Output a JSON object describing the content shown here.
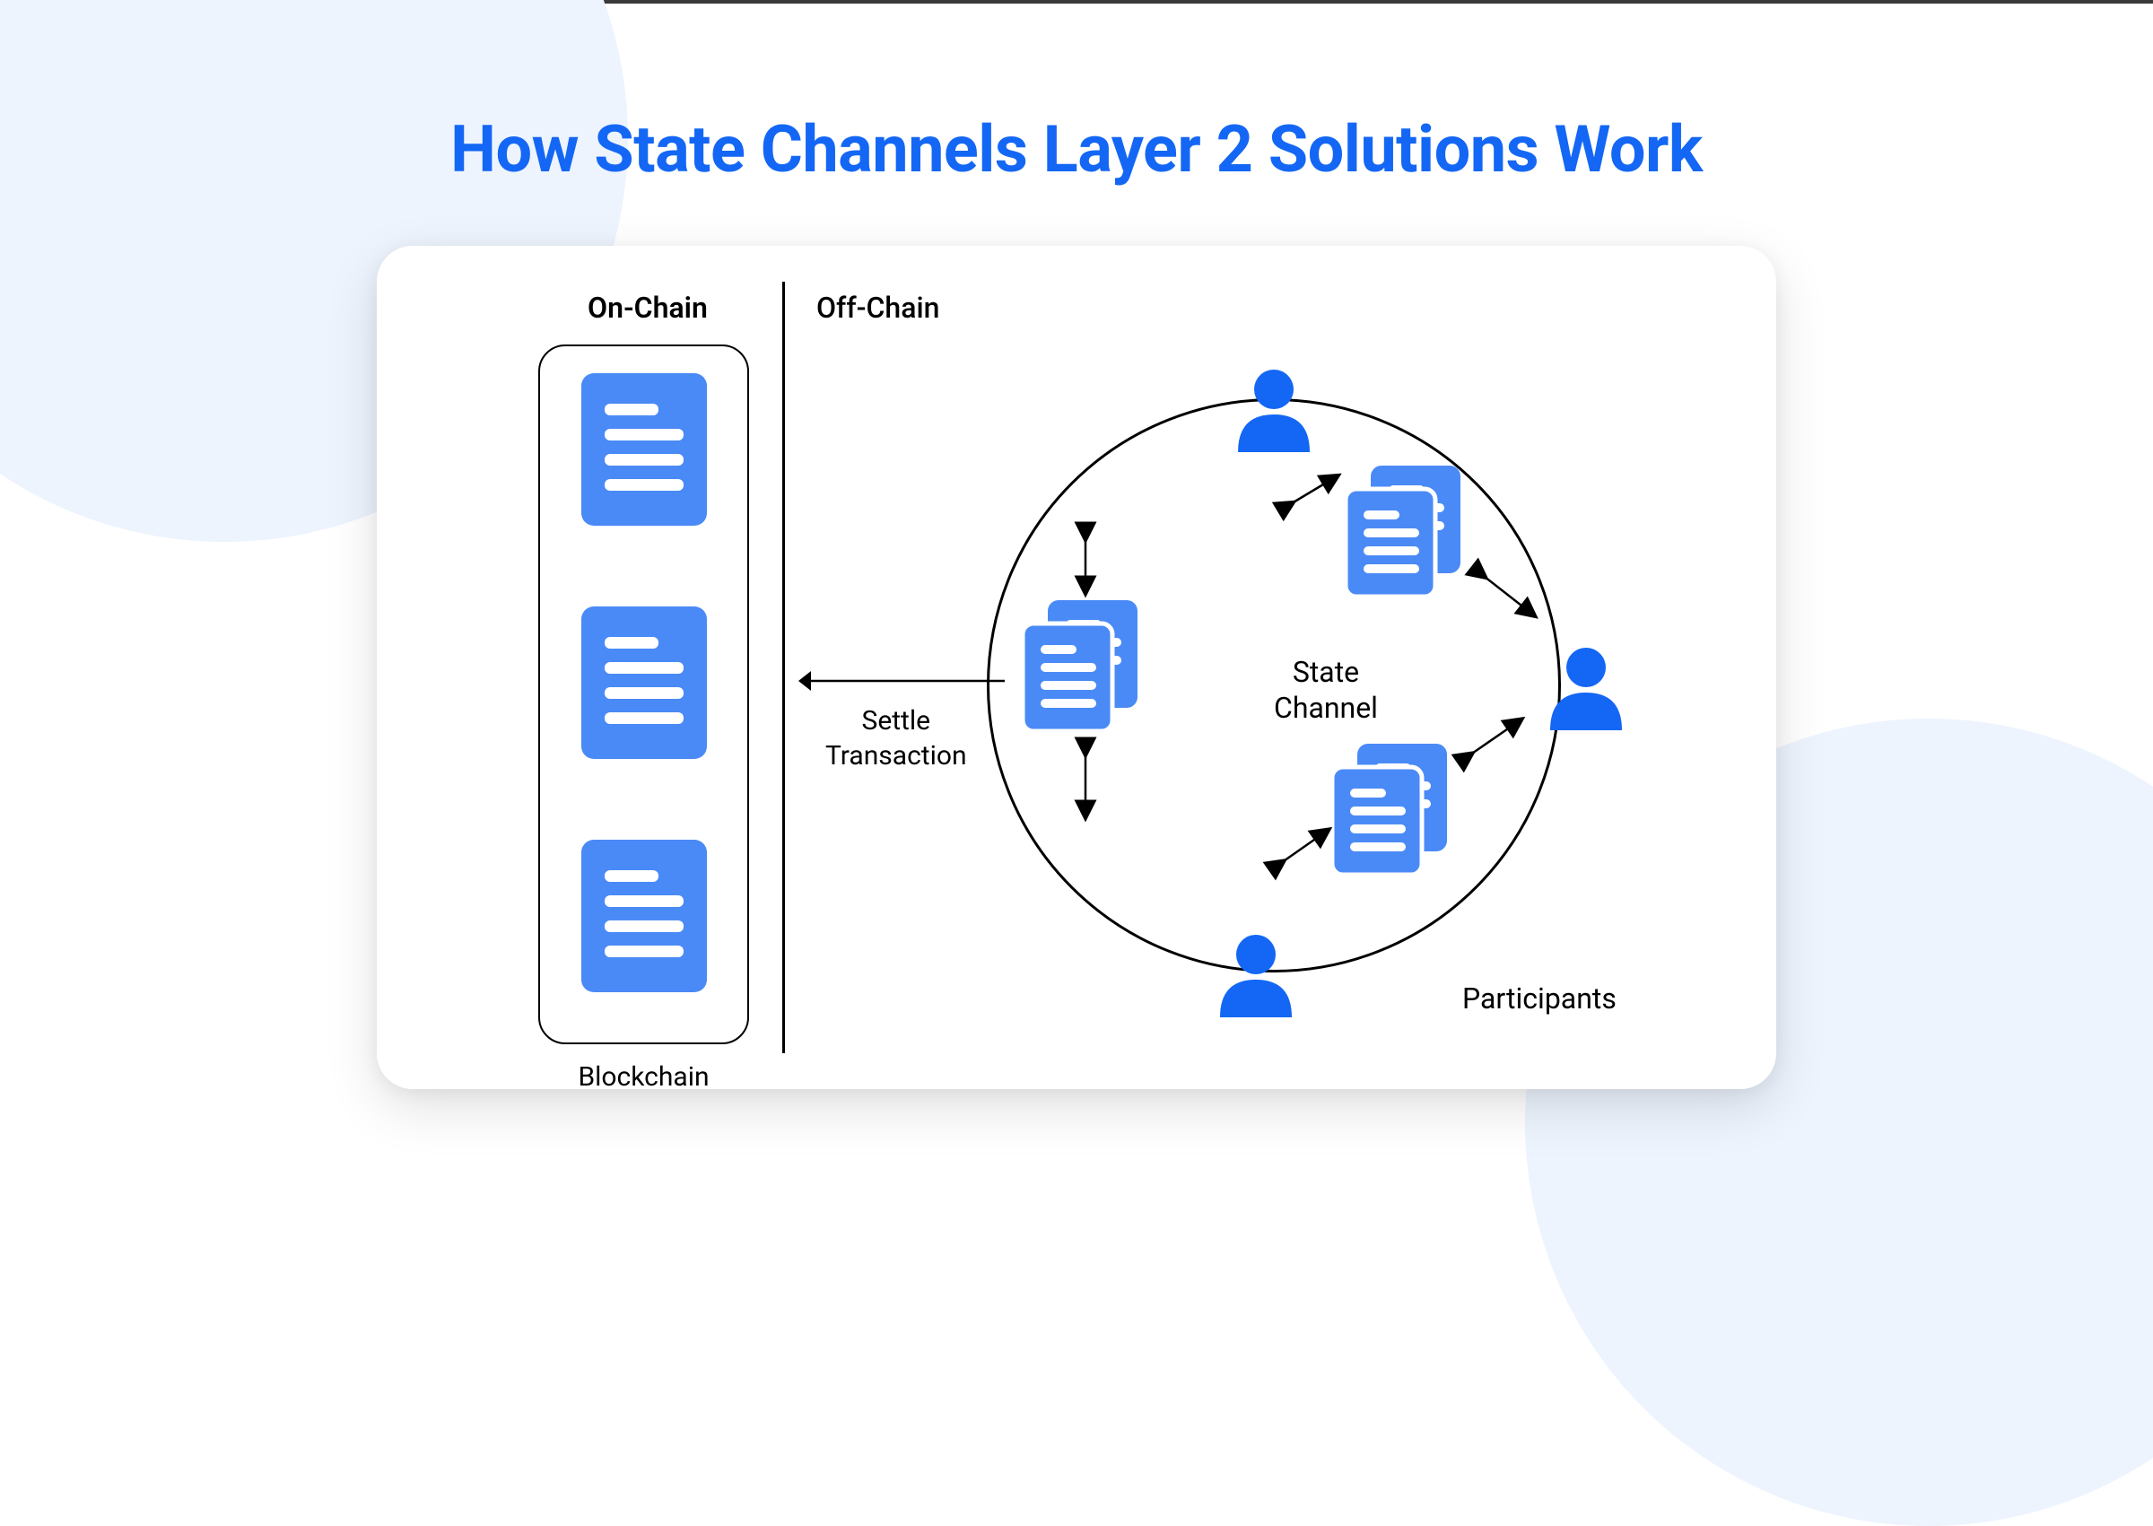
{
  "title": "How State Channels Layer 2 Solutions Work",
  "onchain": {
    "heading": "On-Chain",
    "blockchain_label": "Blockchain"
  },
  "offchain": {
    "heading": "Off-Chain",
    "settle_label": "Settle\nTransaction",
    "state_channel_label": "State\nChannel",
    "participants_label": "Participants"
  },
  "colors": {
    "title": "#1467f4",
    "icon": "#4a8af6",
    "bg_blob": "#edf4fe"
  }
}
